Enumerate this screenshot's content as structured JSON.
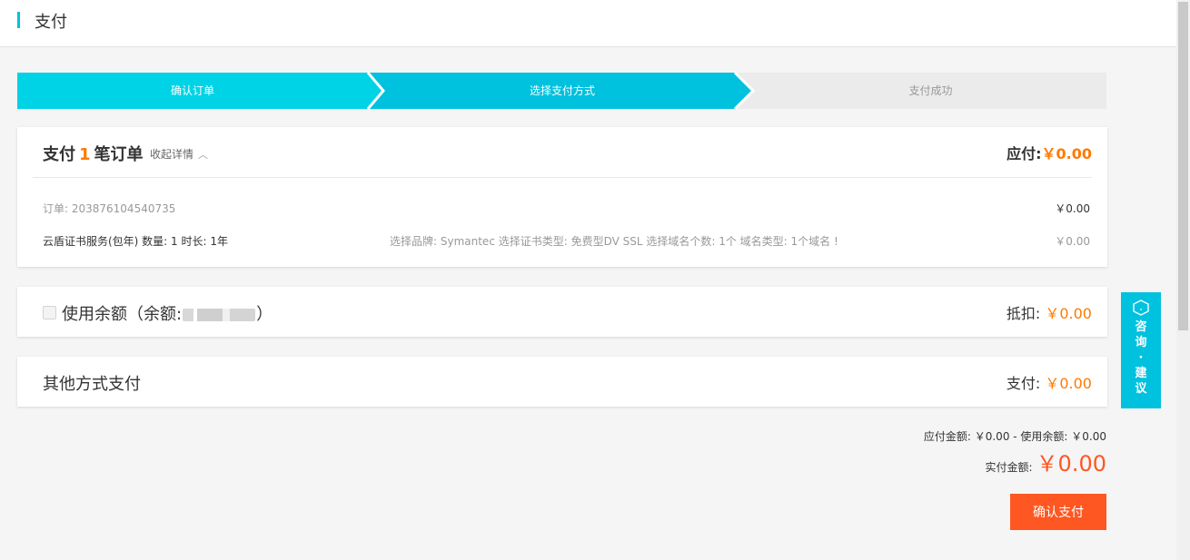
{
  "header": {
    "title": "支付"
  },
  "steps": [
    {
      "label": "确认订单",
      "state": "done"
    },
    {
      "label": "选择支付方式",
      "state": "active"
    },
    {
      "label": "支付成功",
      "state": "pending"
    }
  ],
  "order_summary": {
    "title_prefix": "支付",
    "count": "1",
    "title_suffix": "笔订单",
    "toggle_label": "收起详情",
    "payable_label": "应付:",
    "payable_amount": "￥0.00",
    "order_no": "订单: 203876104540735",
    "order_amount": "￥0.00",
    "item": {
      "name": "云盾证书服务(包年) 数量: 1 时长: 1年",
      "spec": "选择品牌: Symantec 选择证书类型: 免费型DV SSL 选择域名个数: 1个 域名类型: 1个域名 !",
      "amount": "￥0.00"
    }
  },
  "balance": {
    "label_prefix": "使用余额（余额:",
    "label_suffix": "）",
    "deduct_label": "抵扣:",
    "deduct_amount": "￥0.00"
  },
  "other_payment": {
    "label": "其他方式支付",
    "pay_label": "支付:",
    "pay_amount": "￥0.00"
  },
  "totals": {
    "summary_line": "应付金额: ￥0.00 - 使用余额: ￥0.00",
    "actual_label": "实付金额:",
    "actual_amount": "￥0.00"
  },
  "confirm_button": "确认支付",
  "consult": {
    "lines": [
      "咨",
      "询",
      "·",
      "建",
      "议"
    ]
  },
  "colors": {
    "accent": "#00c1de",
    "step_done": "#00d3e6",
    "step_active": "#00c1de",
    "step_pending": "#ebebeb",
    "price": "#ff7a00",
    "button": "#ff5722"
  }
}
